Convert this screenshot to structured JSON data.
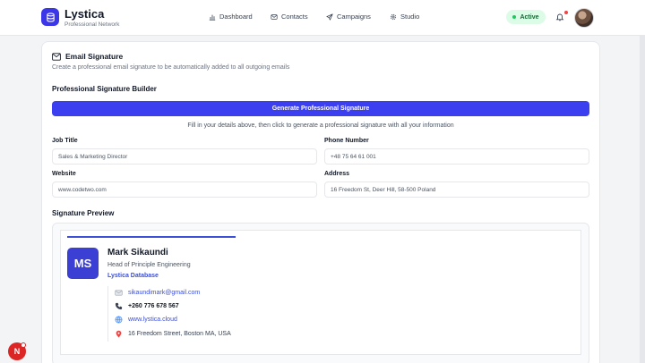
{
  "brand": {
    "name": "Lystica",
    "subtitle": "Professional Network"
  },
  "nav": [
    {
      "label": "Dashboard",
      "icon": "bar-chart-icon"
    },
    {
      "label": "Contacts",
      "icon": "mail-icon"
    },
    {
      "label": "Campaigns",
      "icon": "send-icon"
    },
    {
      "label": "Studio",
      "icon": "gear-icon"
    }
  ],
  "status": {
    "label": "Active",
    "color": "#22c55e"
  },
  "section": {
    "title": "Email Signature",
    "description": "Create a professional email signature to be automatically added to all outgoing emails"
  },
  "builder": {
    "title": "Professional Signature Builder",
    "button_label": "Generate Professional Signature",
    "hint": "Fill in your details above, then click to generate a professional signature with all your information",
    "fields": {
      "job_title": {
        "label": "Job Title",
        "value": "Sales & Marketing Director"
      },
      "phone": {
        "label": "Phone Number",
        "value": "+48 75 64 61 001"
      },
      "website": {
        "label": "Website",
        "value": "www.codetwo.com"
      },
      "address": {
        "label": "Address",
        "value": "16 Freedom St, Deer Hill, 58-500 Poland"
      }
    }
  },
  "preview": {
    "title": "Signature Preview",
    "initials": "MS",
    "name": "Mark Sikaundi",
    "role": "Head of Principle Engineering",
    "company": "Lystica Database",
    "email": "sikaundimark@gmail.com",
    "phone": "+260 776 678 567",
    "website": "www.lystica.cloud",
    "address": "16 Freedom Street, Boston MA, USA"
  },
  "fab": {
    "letter": "N"
  },
  "colors": {
    "accent": "#3b3ff0",
    "link": "#3b4fd8",
    "active_bg": "#dcfce7"
  }
}
